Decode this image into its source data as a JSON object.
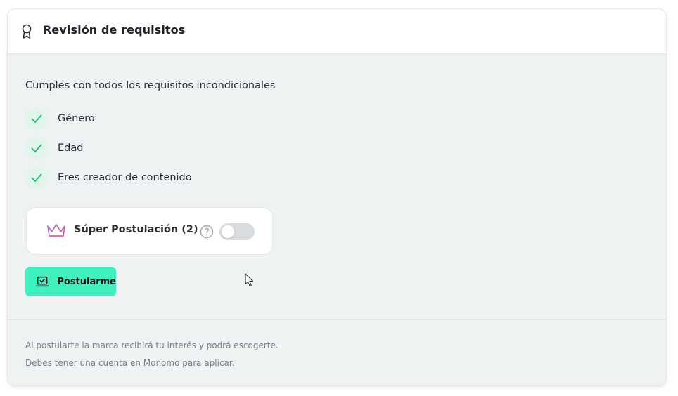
{
  "header": {
    "icon": "award-ribbon-icon",
    "title": "Revisión de requisitos"
  },
  "requirements": {
    "intro": "Cumples con todos los requisitos incondicionales",
    "items": [
      {
        "label": "Género",
        "icon": "check-icon"
      },
      {
        "label": "Edad",
        "icon": "check-icon"
      },
      {
        "label": "Eres creador de contenido",
        "icon": "check-icon"
      }
    ],
    "check_color": "#22b573",
    "check_bg": "#e1f5ea"
  },
  "super_postulacion": {
    "icon": "crown-icon",
    "label": "Súper Postulación (2)",
    "help_icon": "question-circle-icon",
    "toggle_on": false
  },
  "apply_button": {
    "label": "Postularme",
    "icon": "laptop-check-icon",
    "color": "#42f0bf"
  },
  "footer": {
    "line1": "Al postularte la marca recibirá tu interés y podrá escogerte.",
    "line2": "Debes tener una cuenta en Monomo para aplicar."
  }
}
